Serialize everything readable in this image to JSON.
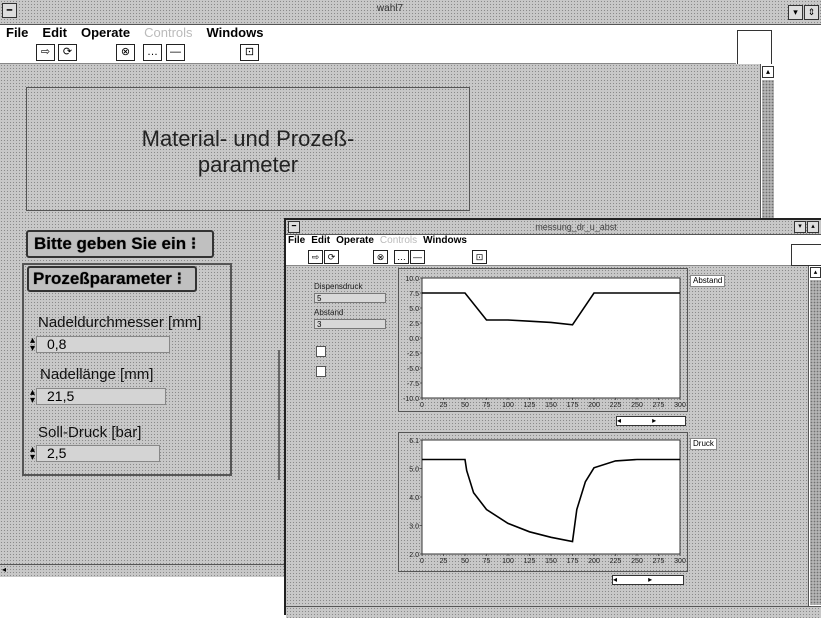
{
  "main_window": {
    "title": "wahl7",
    "menu": [
      "File",
      "Edit",
      "Operate",
      "Controls",
      "Windows"
    ],
    "toolbar_icons": [
      "run-arrow-icon",
      "run-continuous-icon",
      "stop-icon",
      "dots-icon",
      "minus-icon",
      "grid-icon"
    ],
    "title_panel": "Material- und Prozeß-\nparameter",
    "prompt_button": "Bitte geben Sie ein",
    "params_heading": "Prozeßparameter",
    "params": [
      {
        "label": "Nadeldurchmesser [mm]",
        "value": "0,8"
      },
      {
        "label": "Nadellänge [mm]",
        "value": "21,5"
      },
      {
        "label": "Soll-Druck [bar]",
        "value": "2,5"
      }
    ]
  },
  "secondary_window": {
    "title": "messung_dr_u_abst",
    "menu": [
      "File",
      "Edit",
      "Operate",
      "Controls",
      "Windows"
    ],
    "controls": [
      {
        "label": "Dispensdruck",
        "value": "5"
      },
      {
        "label": "Abstand",
        "value": "3"
      }
    ],
    "legend_top": "Abstand",
    "legend_bottom": "Druck"
  },
  "chart_data": [
    {
      "type": "line",
      "series": [
        {
          "name": "Abstand",
          "x": [
            0,
            15,
            50,
            75,
            100,
            125,
            150,
            175,
            200,
            225,
            250,
            275,
            300
          ],
          "y": [
            7.5,
            7.5,
            7.5,
            3,
            3,
            2.8,
            2.6,
            2.2,
            7.5,
            7.5,
            7.5,
            7.5,
            7.5
          ]
        }
      ],
      "x_ticks": [
        "0",
        "25",
        "50",
        "75",
        "100",
        "125",
        "150",
        "175",
        "200",
        "225",
        "250",
        "275",
        "300"
      ],
      "y_ticks": [
        "10.0",
        "7.5",
        "5.0",
        "2.5",
        "0.0",
        "-2.5",
        "-5.0",
        "-7.5",
        "-10.0"
      ],
      "xlim": [
        0,
        300
      ],
      "ylim": [
        -10,
        10
      ]
    },
    {
      "type": "line",
      "series": [
        {
          "name": "Druck",
          "x": [
            0,
            25,
            50,
            52,
            60,
            75,
            100,
            125,
            150,
            175,
            180,
            190,
            200,
            225,
            250,
            275,
            300
          ],
          "y": [
            5.4,
            5.4,
            5.4,
            5.0,
            4.2,
            3.6,
            3.1,
            2.8,
            2.6,
            2.45,
            3.6,
            4.6,
            5.1,
            5.35,
            5.4,
            5.4,
            5.4
          ]
        }
      ],
      "x_ticks": [
        "0",
        "25",
        "50",
        "75",
        "100",
        "125",
        "150",
        "175",
        "200",
        "225",
        "250",
        "275",
        "300"
      ],
      "y_ticks": [
        "6.1",
        "5.0",
        "4.0",
        "3.0",
        "2.0"
      ],
      "ylim": [
        2.0,
        6.1
      ]
    }
  ]
}
